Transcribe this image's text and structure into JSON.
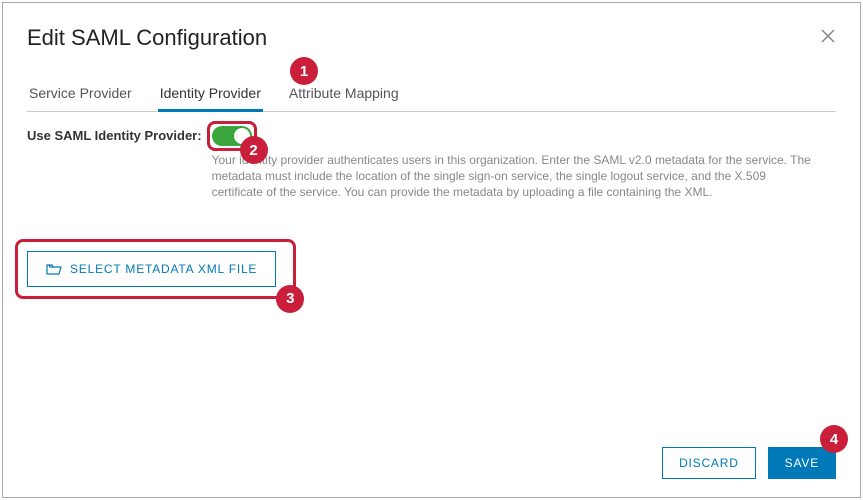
{
  "modal": {
    "title": "Edit SAML Configuration"
  },
  "tabs": {
    "service_provider": "Service Provider",
    "identity_provider": "Identity Provider",
    "attribute_mapping": "Attribute Mapping"
  },
  "idp": {
    "toggle_label": "Use SAML Identity Provider:",
    "help_text": "Your identity provider authenticates users in this organization. Enter the SAML v2.0 metadata for the service. The metadata must include the location of the single sign-on service, the single logout service, and the X.509 certificate of the service. You can provide the metadata by uploading a file containing the XML.",
    "select_file_label": "SELECT METADATA XML FILE"
  },
  "footer": {
    "discard": "DISCARD",
    "save": "SAVE"
  },
  "callouts": {
    "one": "1",
    "two": "2",
    "three": "3",
    "four": "4"
  }
}
